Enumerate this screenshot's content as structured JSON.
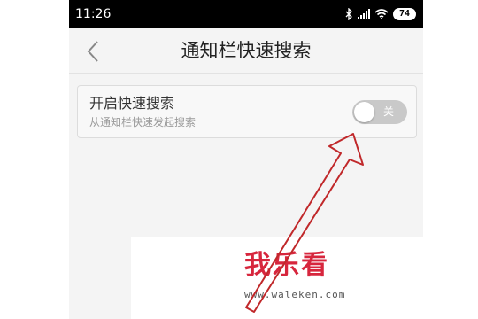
{
  "status_bar": {
    "time": "11:26",
    "battery": "74",
    "icons": [
      "bluetooth-icon",
      "signal-icon",
      "wifi-icon",
      "battery-icon"
    ]
  },
  "header": {
    "title": "通知栏快速搜索",
    "back_icon": "chevron-left-icon"
  },
  "setting": {
    "title": "开启快速搜索",
    "description": "从通知栏快速发起搜索",
    "toggle_label": "关",
    "toggle_state": "off"
  },
  "watermark": {
    "logo": "我乐看",
    "url": "www.waleken.com"
  },
  "colors": {
    "annotation_arrow": "#c0282a",
    "toggle_off": "#c9c9c9",
    "background": "#f4f4f4"
  }
}
